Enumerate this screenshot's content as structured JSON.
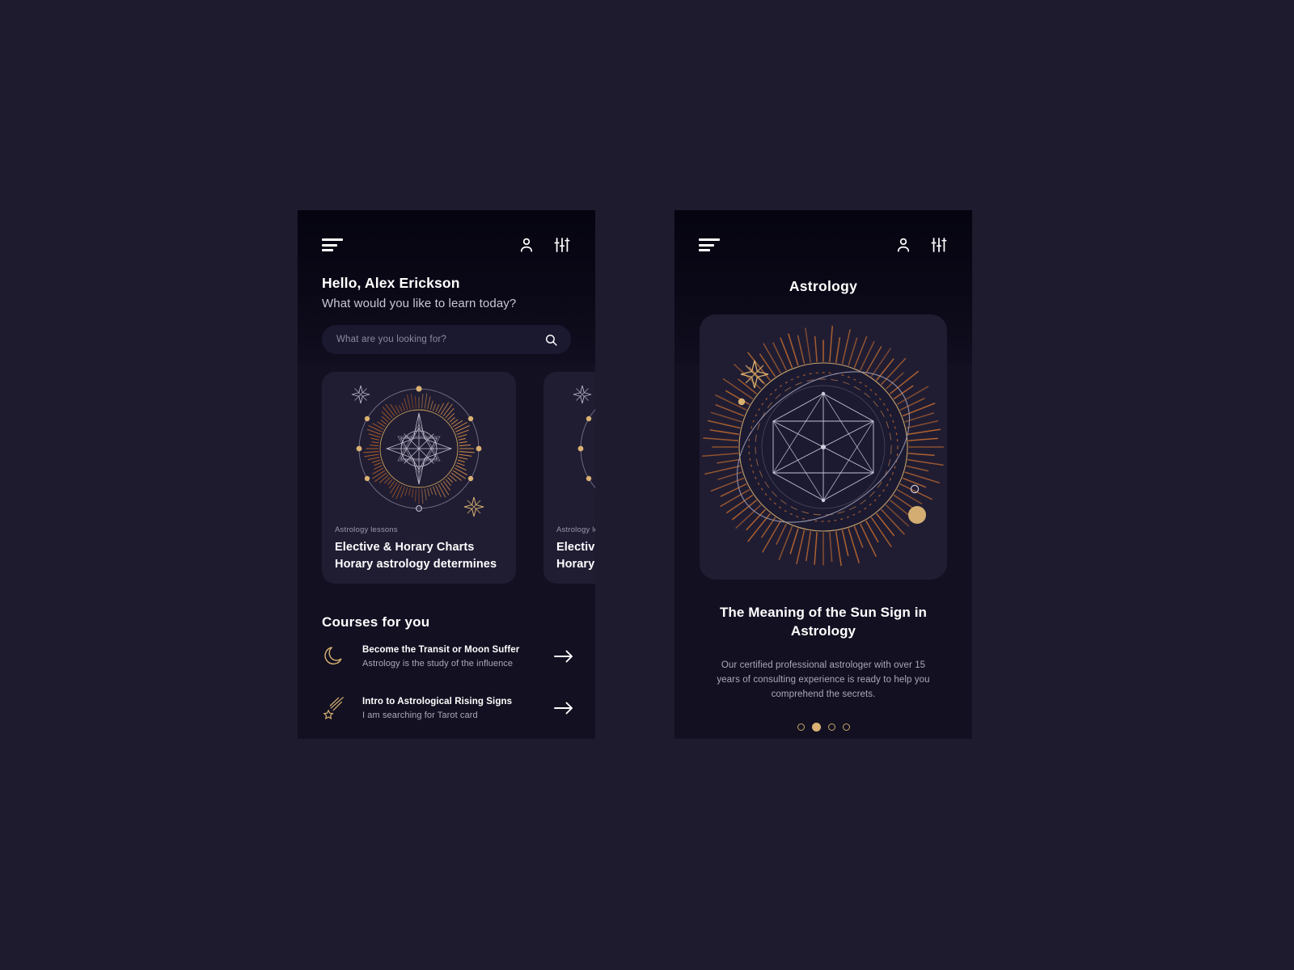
{
  "theme": {
    "page_bg": "#1e1b2e",
    "screen_bg": "#121021",
    "card_bg": "#201d33",
    "accent_gold": "#d9b172",
    "accent_copper": "#b5652f",
    "text_primary": "#ffffff",
    "text_muted": "#aaa8bb"
  },
  "home": {
    "menu_icon": "hamburger-menu-icon",
    "profile_icon": "user-profile-icon",
    "filter_icon": "sliders-filter-icon",
    "hello": "Hello, Alex Erickson",
    "subtitle": "What would you like to learn today?",
    "search": {
      "placeholder": "What are you looking for?",
      "value": "",
      "icon": "search-icon"
    },
    "cards": [
      {
        "kicker": "Astrology lessons",
        "title_line1": "Elective & Horary Charts",
        "title_line2": "Horary astrology determines",
        "art": "astrology-compass-illustration"
      },
      {
        "kicker": "Astrology lessons",
        "title_line1": "Elective & Horary Charts",
        "title_line2": "Horary astrology determines",
        "art": "astrology-compass-illustration"
      }
    ],
    "courses_heading": "Courses for you",
    "courses": [
      {
        "icon": "crescent-moon-icon",
        "name": "Become the Transit or Moon Suffer",
        "desc": "Astrology is the study of the influence",
        "arrow": "arrow-right-icon"
      },
      {
        "icon": "shooting-star-icon",
        "name": "Intro to Astrological Rising Signs",
        "desc": "I am searching for Tarot card",
        "arrow": "arrow-right-icon"
      }
    ]
  },
  "detail": {
    "menu_icon": "hamburger-menu-icon",
    "profile_icon": "user-profile-icon",
    "filter_icon": "sliders-filter-icon",
    "title": "Astrology",
    "hero_art": "sun-sign-mandala-illustration",
    "heading": "The Meaning of the Sun Sign in Astrology",
    "body": "Our certified professional astrologer with over 15 years of consulting experience is ready to help you comprehend the secrets.",
    "pagination": {
      "total": 4,
      "active_index": 1
    }
  }
}
